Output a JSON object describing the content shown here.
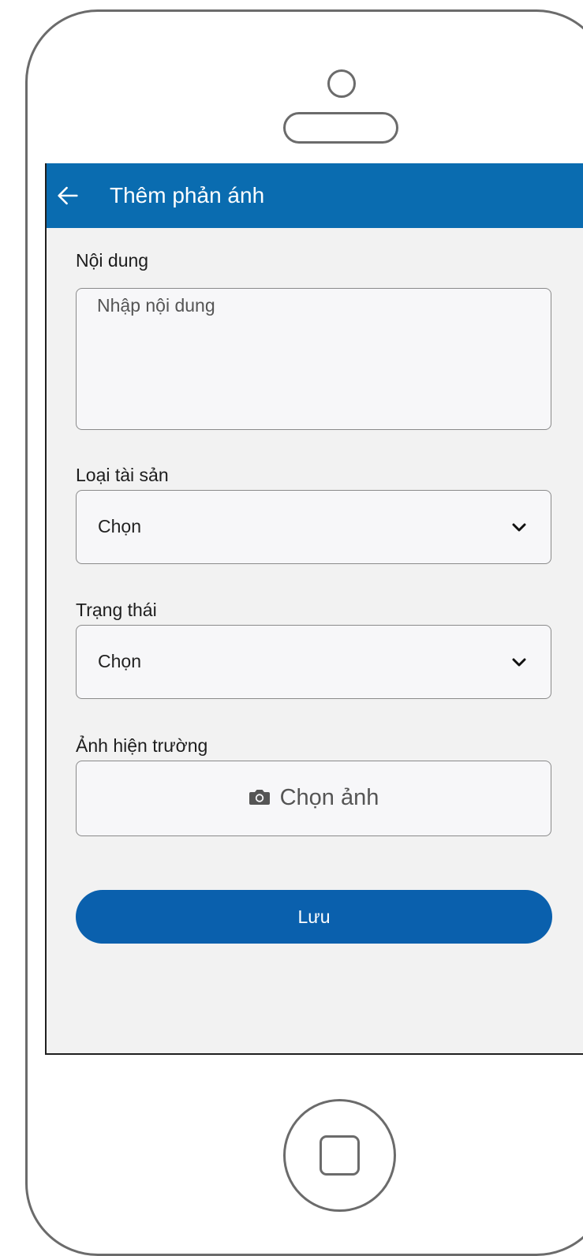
{
  "app_bar": {
    "title": "Thêm phản ánh",
    "back_icon": "arrow-left-icon",
    "background": "#0a6cb0"
  },
  "form": {
    "content": {
      "label": "Nội dung",
      "placeholder": "Nhập nội dung"
    },
    "asset_type": {
      "label": "Loại tài sản",
      "selected": "Chọn",
      "icon": "chevron-down-icon"
    },
    "status": {
      "label": "Trạng thái",
      "selected": "Chọn",
      "icon": "chevron-down-icon"
    },
    "scene_photo": {
      "label": "Ảnh hiện trường",
      "button_label": "Chọn ảnh",
      "icon": "camera-icon"
    },
    "save_label": "Lưu",
    "save_color": "#0a60ad"
  }
}
